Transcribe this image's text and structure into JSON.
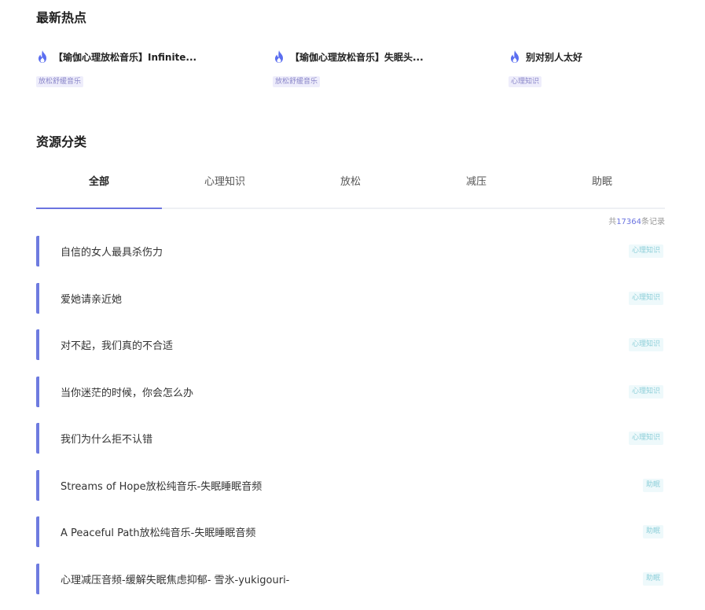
{
  "hot": {
    "title": "最新热点",
    "items": [
      {
        "name": "【瑜伽心理放松音乐】Infinite...",
        "tag": "放松舒缓音乐"
      },
      {
        "name": "【瑜伽心理放松音乐】失眠头...",
        "tag": "放松舒缓音乐"
      },
      {
        "name": "别对别人太好",
        "tag": "心理知识"
      }
    ]
  },
  "categories": {
    "title": "资源分类",
    "tabs": [
      "全部",
      "心理知识",
      "放松",
      "减压",
      "助眠"
    ],
    "active_tab": "全部",
    "total_prefix": "共",
    "total_count": "17364",
    "total_suffix": "条记录",
    "list": [
      {
        "title": "自信的女人最具杀伤力",
        "tag": "心理知识"
      },
      {
        "title": "爱她请亲近她",
        "tag": "心理知识"
      },
      {
        "title": "对不起，我们真的不合适",
        "tag": "心理知识"
      },
      {
        "title": "当你迷茫的时候，你会怎么办",
        "tag": "心理知识"
      },
      {
        "title": "我们为什么拒不认错",
        "tag": "心理知识"
      },
      {
        "title": "Streams of Hope放松纯音乐-失眠睡眠音频",
        "tag": "助眠"
      },
      {
        "title": "A Peaceful Path放松纯音乐-失眠睡眠音频",
        "tag": "助眠"
      },
      {
        "title": "心理减压音频-缓解失眠焦虑抑郁- 雪氷-yukigouri-",
        "tag": "助眠"
      }
    ]
  },
  "colors": {
    "accent": "#6b74e0",
    "fire": "#5b6ef0",
    "hot_tag_bg": "#eeedfb",
    "list_tag_bg": "#eef9fb"
  },
  "icons": {
    "hot_item": "fire-icon"
  }
}
